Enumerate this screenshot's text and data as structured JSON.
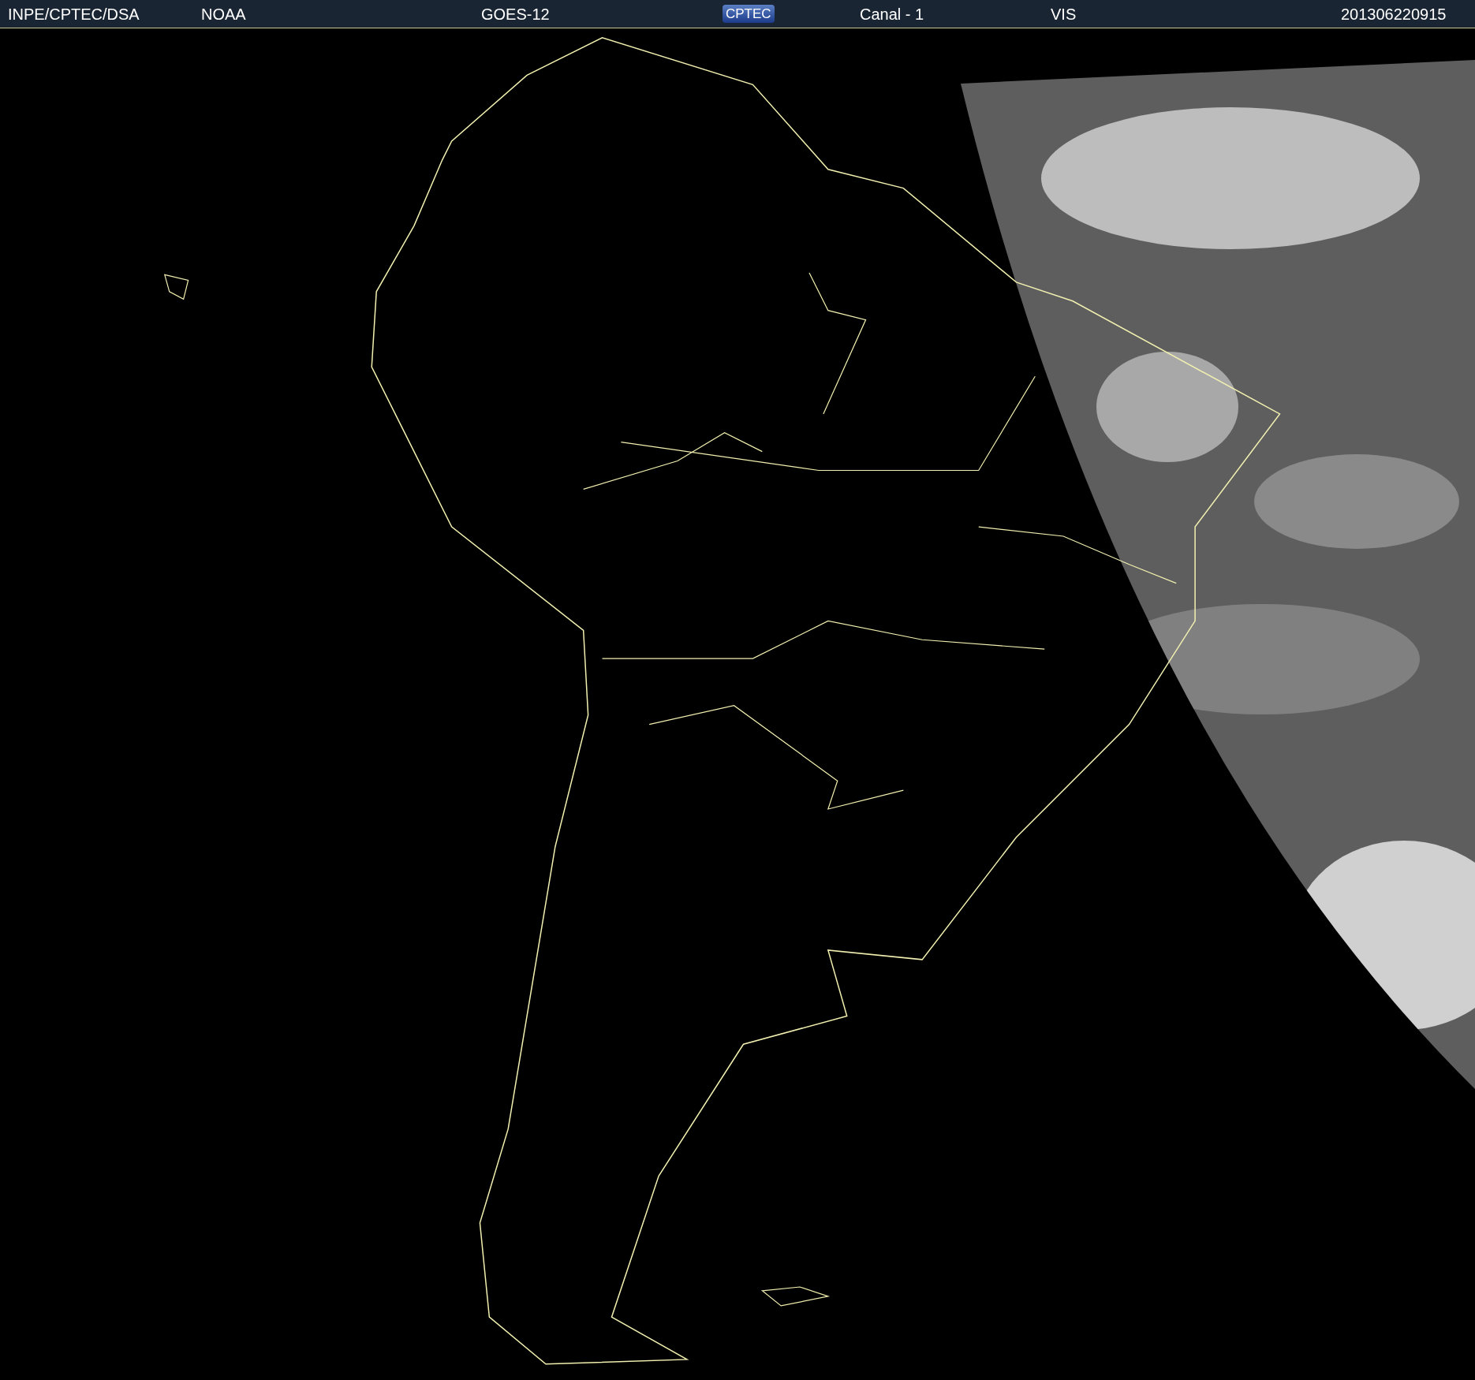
{
  "header": {
    "items": [
      {
        "kind": "text",
        "text": "INPE/CPTEC/DSA"
      },
      {
        "kind": "text",
        "text": "NOAA"
      },
      {
        "kind": "text",
        "text": "GOES-12"
      },
      {
        "kind": "logo",
        "text": "CPTEC"
      },
      {
        "kind": "text",
        "text": "Canal - 1"
      },
      {
        "kind": "text",
        "text": "VIS"
      },
      {
        "kind": "text",
        "text": "201306220915"
      }
    ]
  }
}
